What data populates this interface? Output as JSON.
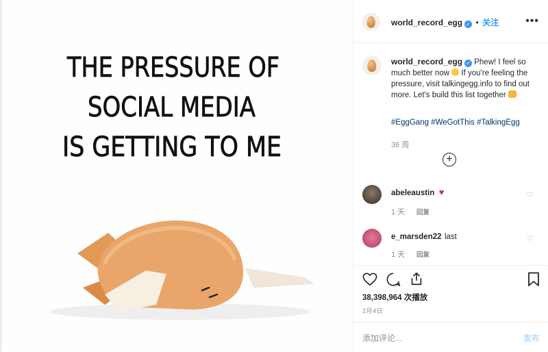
{
  "post": {
    "image_text": [
      "THE PRESSURE OF",
      "SOCIAL MEDIA",
      "IS GETTING TO ME"
    ]
  },
  "header": {
    "username": "world_record_egg",
    "follow_label": "关注",
    "more_icon": "more-horizontal-icon"
  },
  "caption": {
    "username": "world_record_egg",
    "text_part1": "Phew! I feel so much better now",
    "text_part2": "If you're feeling the pressure, visit talkingegg.info to find out more. Let's build this list together",
    "hashtags": "#EggGang #WeGotThis #TalkingEgg",
    "time": "36 周"
  },
  "comments": [
    {
      "username": "abeleaustin",
      "text": "",
      "time": "1 天",
      "reply_label": "回复"
    },
    {
      "username": "e_marsden22",
      "text": "last",
      "time": "1 天",
      "reply_label": "回复"
    }
  ],
  "actions": {
    "likes": "38,398,964 次播放",
    "date": "2月4日"
  },
  "add_comment": {
    "placeholder": "添加评论...",
    "post_label": "发布"
  },
  "colors": {
    "link": "#3897f0",
    "hashtag": "#003569",
    "muted": "#8e8e8e",
    "like_heart": "#ed4956"
  }
}
